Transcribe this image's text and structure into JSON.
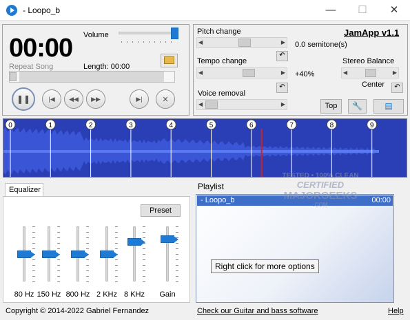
{
  "window": {
    "title": "- Loopo_b",
    "minimize": "—",
    "maximize": "☐",
    "close": "✕"
  },
  "player": {
    "time": "00:00",
    "volume_label": "Volume",
    "repeat_label": "Repeat Song",
    "length_label": "Length: 00:00",
    "volume_level": 0.95,
    "buttons": {
      "pause": "❚❚",
      "prev": "|◀",
      "rewind": "◀◀",
      "forward": "▶▶",
      "next": "▶|",
      "stop": "✕"
    }
  },
  "controls": {
    "pitch_label": "Pitch change",
    "pitch_value": "0.0 semitone(s)",
    "tempo_label": "Tempo change",
    "tempo_value": "+40%",
    "voice_label": "Voice removal",
    "stereo_label": "Stereo Balance",
    "stereo_value": "Center",
    "app_name": "JamApp v1.1",
    "top_button": "Top"
  },
  "waveform": {
    "markers": [
      "0",
      "1",
      "2",
      "3",
      "4",
      "5",
      "6",
      "7",
      "8",
      "9"
    ],
    "playhead_fraction": 0.64
  },
  "equalizer": {
    "tab_label": "Equalizer",
    "preset_button": "Preset",
    "bands": [
      {
        "label": "80 Hz",
        "level": 0.5
      },
      {
        "label": "150 Hz",
        "level": 0.5
      },
      {
        "label": "800 Hz",
        "level": 0.5
      },
      {
        "label": "2 KHz",
        "level": 0.5
      },
      {
        "label": "8 KHz",
        "level": 0.28
      },
      {
        "label": "Gain",
        "level": 0.22
      }
    ]
  },
  "playlist": {
    "label": "Playlist",
    "items": [
      {
        "name": "- Loopo_b",
        "duration": "00:00"
      }
    ],
    "tooltip": "Right click for more options"
  },
  "footer": {
    "copyright": "Copyright © 2014-2022 Gabriel Fernandez",
    "link": "Check our Guitar and bass software",
    "help": "Help"
  },
  "watermark": {
    "line1": "TESTED • 100% CLEAN",
    "line2": "CERTIFIED",
    "line3": "MAJORGEEKS",
    "line4": ".COM"
  },
  "colors": {
    "accent": "#1f7ad3",
    "wave": "#3a55d6",
    "wave_bg": "#1b2f9c",
    "playhead": "#d42020",
    "selection": "#3f6ec9"
  }
}
